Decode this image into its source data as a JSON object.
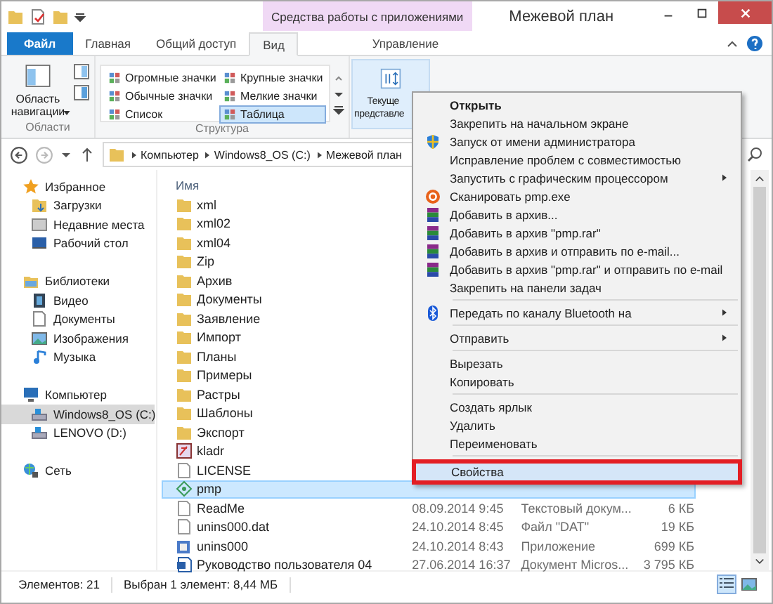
{
  "title_bar": {
    "contextual_group": "Средства работы с приложениями",
    "title": "Межевой план"
  },
  "ribbon_tabs": [
    {
      "label": "Файл",
      "kind": "file",
      "selected": false
    },
    {
      "label": "Главная",
      "kind": "tab",
      "selected": false
    },
    {
      "label": "Общий доступ",
      "kind": "tab",
      "selected": false
    },
    {
      "label": "Вид",
      "kind": "tab",
      "selected": true
    },
    {
      "label": "Управление",
      "kind": "contextual",
      "selected": false
    }
  ],
  "ribbon": {
    "navigation_pane": "Область навигации",
    "areas_group": "Области",
    "layout_group": "Структура",
    "layouts": [
      {
        "label": "Огромные значки",
        "selected": false
      },
      {
        "label": "Обычные значки",
        "selected": false
      },
      {
        "label": "Список",
        "selected": false
      },
      {
        "label": "Крупные значки",
        "selected": false
      },
      {
        "label": "Мелкие значки",
        "selected": false
      },
      {
        "label": "Таблица",
        "selected": true
      }
    ],
    "current_view": [
      "Текуще",
      "представле"
    ]
  },
  "address_bar": {
    "breadcrumb": [
      "Компьютер",
      "Windows8_OS (C:)",
      "Межевой план"
    ]
  },
  "nav_pane": [
    {
      "label": "Избранное",
      "children": [
        {
          "label": "Загрузки",
          "selected": false
        },
        {
          "label": "Недавние места",
          "selected": false
        },
        {
          "label": "Рабочий стол",
          "selected": false
        }
      ]
    },
    {
      "label": "Библиотеки",
      "children": [
        {
          "label": "Видео",
          "selected": false
        },
        {
          "label": "Документы",
          "selected": false
        },
        {
          "label": "Изображения",
          "selected": false
        },
        {
          "label": "Музыка",
          "selected": false
        }
      ]
    },
    {
      "label": "Компьютер",
      "children": [
        {
          "label": "Windows8_OS (C:)",
          "selected": true
        },
        {
          "label": "LENOVO (D:)",
          "selected": false
        }
      ]
    },
    {
      "label": "Сеть"
    }
  ],
  "file_list": {
    "column_name": "Имя",
    "rows": [
      {
        "name": "xml",
        "kind": "folder",
        "selected": false
      },
      {
        "name": "xml02",
        "kind": "folder",
        "selected": false
      },
      {
        "name": "xml04",
        "kind": "folder",
        "selected": false
      },
      {
        "name": "Zip",
        "kind": "folder",
        "selected": false
      },
      {
        "name": "Архив",
        "kind": "folder",
        "selected": false
      },
      {
        "name": "Документы",
        "kind": "folder",
        "selected": false
      },
      {
        "name": "Заявление",
        "kind": "folder",
        "selected": false
      },
      {
        "name": "Импорт",
        "kind": "folder",
        "selected": false
      },
      {
        "name": "Планы",
        "kind": "folder",
        "selected": false
      },
      {
        "name": "Примеры",
        "kind": "folder",
        "selected": false
      },
      {
        "name": "Растры",
        "kind": "folder",
        "selected": false
      },
      {
        "name": "Шаблоны",
        "kind": "folder",
        "selected": false
      },
      {
        "name": "Экспорт",
        "kind": "folder",
        "selected": false
      },
      {
        "name": "kladr",
        "kind": "program",
        "selected": false
      },
      {
        "name": "LICENSE",
        "kind": "file",
        "selected": false
      },
      {
        "name": "pmp",
        "kind": "application",
        "selected": true
      },
      {
        "name": "ReadMe",
        "kind": "file",
        "selected": false,
        "date": "08.09.2014 9:45",
        "type": "Текстовый докум...",
        "size": "6 КБ"
      },
      {
        "name": "unins000.dat",
        "kind": "file",
        "selected": false,
        "date": "24.10.2014 8:45",
        "type": "Файл \"DAT\"",
        "size": "19 КБ"
      },
      {
        "name": "unins000",
        "kind": "setup",
        "selected": false,
        "date": "24.10.2014 8:43",
        "type": "Приложение",
        "size": "699 КБ"
      },
      {
        "name": "Руководство пользователя 04",
        "kind": "document",
        "selected": false,
        "date": "27.06.2014 16:37",
        "type": "Документ Micros...",
        "size": "3 795 КБ"
      }
    ]
  },
  "status_bar": {
    "count": "Элементов: 21",
    "selection": "Выбран 1 элемент: 8,44 МБ"
  },
  "context_menu": [
    {
      "kind": "item",
      "label": "Открыть",
      "bold": true,
      "submenu": false,
      "selected": false
    },
    {
      "kind": "item",
      "label": "Закрепить на начальном экране",
      "bold": false,
      "submenu": false,
      "selected": false
    },
    {
      "kind": "item",
      "label": "Запуск от имени администратора",
      "bold": false,
      "submenu": false,
      "selected": false
    },
    {
      "kind": "item",
      "label": "Исправление проблем с совместимостью",
      "bold": false,
      "submenu": false,
      "selected": false
    },
    {
      "kind": "item",
      "label": "Запустить с графическим процессором",
      "bold": false,
      "submenu": true,
      "selected": false
    },
    {
      "kind": "item",
      "label": "Сканировать pmp.exe",
      "bold": false,
      "submenu": false,
      "selected": false
    },
    {
      "kind": "item",
      "label": "Добавить в архив...",
      "bold": false,
      "submenu": false,
      "selected": false
    },
    {
      "kind": "item",
      "label": "Добавить в архив \"pmp.rar\"",
      "bold": false,
      "submenu": false,
      "selected": false
    },
    {
      "kind": "item",
      "label": "Добавить в архив и отправить по e-mail...",
      "bold": false,
      "submenu": false,
      "selected": false
    },
    {
      "kind": "item",
      "label": "Добавить в архив \"pmp.rar\" и отправить по e-mail",
      "bold": false,
      "submenu": false,
      "selected": false
    },
    {
      "kind": "item",
      "label": "Закрепить на панели задач",
      "bold": false,
      "submenu": false,
      "selected": false
    },
    {
      "kind": "separator"
    },
    {
      "kind": "item",
      "label": "Передать по каналу Bluetooth на",
      "bold": false,
      "submenu": true,
      "selected": false
    },
    {
      "kind": "separator"
    },
    {
      "kind": "item",
      "label": "Отправить",
      "bold": false,
      "submenu": true,
      "selected": false
    },
    {
      "kind": "separator"
    },
    {
      "kind": "item",
      "label": "Вырезать",
      "bold": false,
      "submenu": false,
      "selected": false
    },
    {
      "kind": "item",
      "label": "Копировать",
      "bold": false,
      "submenu": false,
      "selected": false
    },
    {
      "kind": "separator"
    },
    {
      "kind": "item",
      "label": "Создать ярлык",
      "bold": false,
      "submenu": false,
      "selected": false
    },
    {
      "kind": "item",
      "label": "Удалить",
      "bold": false,
      "submenu": false,
      "selected": false
    },
    {
      "kind": "item",
      "label": "Переименовать",
      "bold": false,
      "submenu": false,
      "selected": false
    },
    {
      "kind": "separator"
    },
    {
      "kind": "item",
      "label": "Свойства",
      "bold": false,
      "submenu": false,
      "selected": true,
      "outlined": true
    }
  ]
}
